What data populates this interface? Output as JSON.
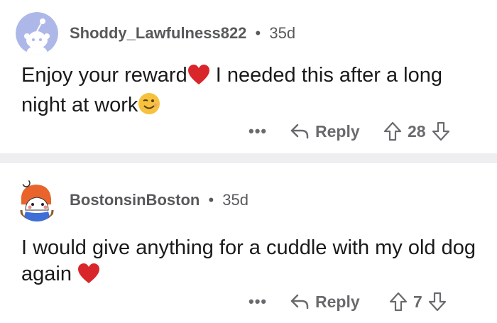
{
  "comments": [
    {
      "username": "Shoddy_Lawfulness822",
      "separator": "•",
      "age": "35d",
      "text_part1": "Enjoy your reward",
      "text_part2": " I needed this after a long night at work",
      "emoji_1": "heart-emoji",
      "emoji_2": "wink-emoji",
      "more_label": "•••",
      "reply_label": "Reply",
      "vote_count": "28"
    },
    {
      "username": "BostonsinBoston",
      "separator": "•",
      "age": "35d",
      "text_part1": "I would give anything for a cuddle with my old dog again",
      "emoji_1": "heart-emoji",
      "more_label": "•••",
      "reply_label": "Reply",
      "vote_count": "7"
    }
  ],
  "colors": {
    "text": "#1a1a1b",
    "meta": "#58595b",
    "divider": "#eeeef0",
    "heart": "#d9262b",
    "avatar_bg": "#aeb8e8"
  }
}
